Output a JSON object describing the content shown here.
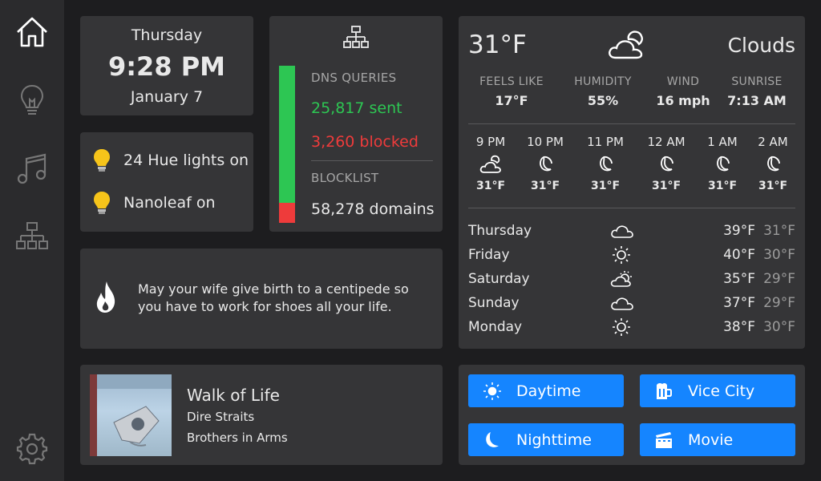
{
  "sidebar": {
    "items": [
      "home-icon",
      "bulb-icon",
      "music-icon",
      "network-icon",
      "gear-icon"
    ]
  },
  "clock": {
    "day": "Thursday",
    "time": "9:28 PM",
    "date": "January 7"
  },
  "lights": {
    "hue": "24 Hue lights on",
    "nanoleaf": "Nanoleaf on"
  },
  "dns": {
    "queries_label": "DNS QUERIES",
    "sent": "25,817 sent",
    "blocked": "3,260 blocked",
    "blocklist_label": "BLOCKLIST",
    "domains": "58,278 domains",
    "blocked_fraction": 0.126,
    "colors": {
      "sent": "#2dc653",
      "blocked": "#ee3b3b"
    }
  },
  "quote": {
    "text": "May your wife give birth to a centipede so you have to work for shoes all your life."
  },
  "weather": {
    "current_temp": "31°F",
    "condition": "Clouds",
    "stats": [
      {
        "label": "FEELS LIKE",
        "value": "17°F"
      },
      {
        "label": "HUMIDITY",
        "value": "55%"
      },
      {
        "label": "WIND",
        "value": "16 mph"
      },
      {
        "label": "SUNRISE",
        "value": "7:13 AM"
      }
    ],
    "hourly": [
      {
        "time": "9 PM",
        "icon": "cloud-moon-icon",
        "temp": "31°F"
      },
      {
        "time": "10 PM",
        "icon": "moon-icon",
        "temp": "31°F"
      },
      {
        "time": "11 PM",
        "icon": "moon-icon",
        "temp": "31°F"
      },
      {
        "time": "12 AM",
        "icon": "moon-icon",
        "temp": "31°F"
      },
      {
        "time": "1 AM",
        "icon": "moon-icon",
        "temp": "31°F"
      },
      {
        "time": "2 AM",
        "icon": "moon-icon",
        "temp": "31°F"
      }
    ],
    "daily": [
      {
        "day": "Thursday",
        "icon": "cloud-icon",
        "high": "39°F",
        "low": "31°F"
      },
      {
        "day": "Friday",
        "icon": "sun-icon",
        "high": "40°F",
        "low": "30°F"
      },
      {
        "day": "Saturday",
        "icon": "partly-cloudy-icon",
        "high": "35°F",
        "low": "29°F"
      },
      {
        "day": "Sunday",
        "icon": "cloud-icon",
        "high": "37°F",
        "low": "29°F"
      },
      {
        "day": "Monday",
        "icon": "sun-icon",
        "high": "38°F",
        "low": "30°F"
      }
    ]
  },
  "music": {
    "title": "Walk of Life",
    "artist": "Dire Straits",
    "album": "Brothers in Arms"
  },
  "scenes": {
    "daytime": "Daytime",
    "vice_city": "Vice City",
    "nighttime": "Nighttime",
    "movie": "Movie",
    "color": "#1585ff"
  }
}
